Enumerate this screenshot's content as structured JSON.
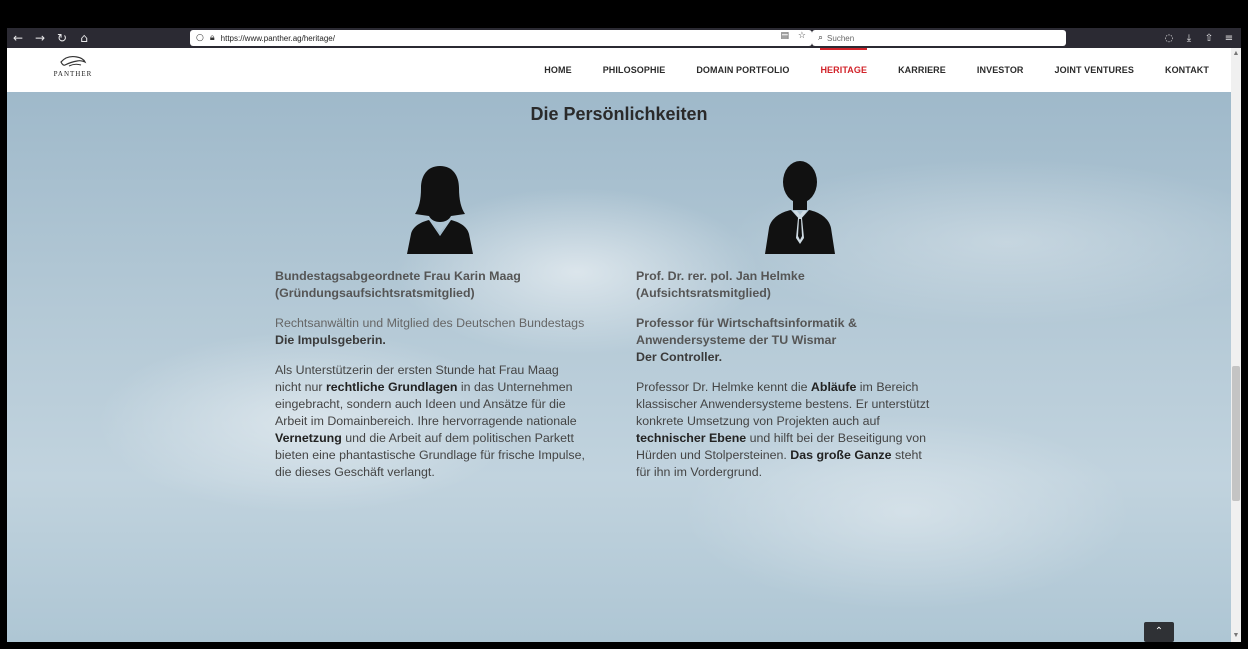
{
  "browser": {
    "url": "https://www.panther.ag/heritage/",
    "search_placeholder": "Suchen",
    "nav_icons": [
      "back-icon",
      "forward-icon",
      "reload-icon",
      "home-icon"
    ]
  },
  "site": {
    "logo_text": "PANTHER",
    "menu": [
      "HOME",
      "PHILOSOPHIE",
      "DOMAIN PORTFOLIO",
      "HERITAGE",
      "KARRIERE",
      "INVESTOR",
      "JOINT VENTURES",
      "KONTAKT"
    ],
    "active_menu": "HERITAGE",
    "accent_color": "#d2232a"
  },
  "section": {
    "title": "Die Persönlichkeiten"
  },
  "persons": {
    "left": {
      "name": "Bundestagsabgeordnete Frau Karin Maag",
      "title": "(Gründungsaufsichtsratsmitglied)",
      "role": "Rechtsanwältin und Mitglied des Deutschen Bundestags",
      "tagline": "Die Impulsgeberin.",
      "bio_1": "Als Unterstützerin der ersten Stunde hat Frau Maag nicht nur ",
      "bio_b1": "rechtliche Grundlagen",
      "bio_2": " in das Unternehmen eingebracht, sondern auch Ideen und Ansätze für die Arbeit im Domainbereich. Ihre hervorragende nationale ",
      "bio_b2": "Vernetzung",
      "bio_3": " und die Arbeit auf dem politischen Parkett bieten eine phantastische Grundlage für frische Impulse, die dieses Geschäft verlangt."
    },
    "right": {
      "name": "Prof. Dr. rer. pol. Jan Helmke",
      "title": "(Aufsichtsratsmitglied)",
      "role": "Professor für Wirtschaftsinformatik & Anwendersysteme der TU Wismar",
      "tagline": "Der Controller.",
      "bio_1": "Professor Dr. Helmke kennt die ",
      "bio_b1": "Abläufe",
      "bio_2": " im Bereich klassischer Anwendersysteme bestens. Er unterstützt konkrete Umsetzung von Projekten auch auf ",
      "bio_b2": "technischer Ebene",
      "bio_3": " und hilft bei der Beseitigung von Hürden und Stolpersteinen. ",
      "bio_b3": "Das große Ganze",
      "bio_4": " steht für ihn im Vordergrund."
    }
  }
}
